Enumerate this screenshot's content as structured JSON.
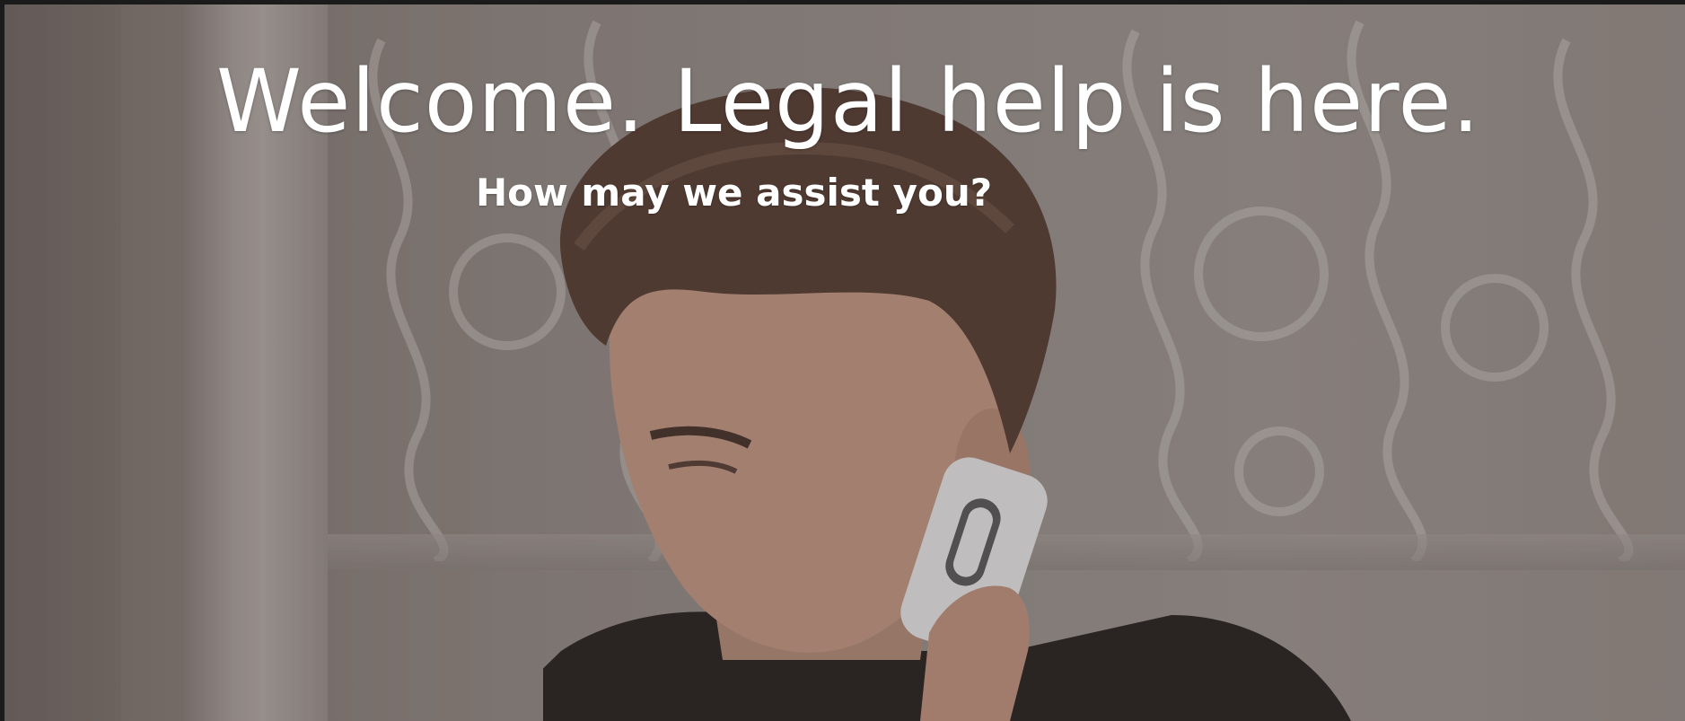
{
  "hero": {
    "headline": "Welcome. Legal help is here.",
    "subheadline": "How may we assist you?",
    "background_image": "man-on-phone-photo"
  },
  "colors": {
    "text": "#ffffff",
    "frame": "#1b1b1b"
  }
}
